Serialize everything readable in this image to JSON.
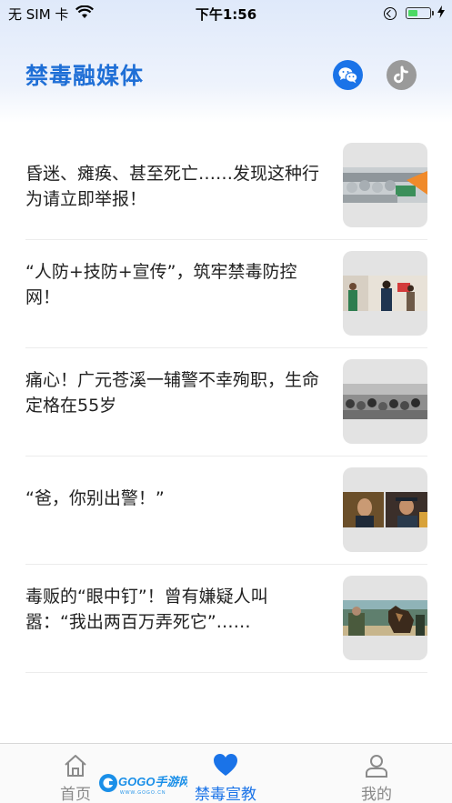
{
  "status_bar": {
    "carrier": "无 SIM 卡",
    "time": "下午1:56",
    "battery_level": 0.45
  },
  "header": {
    "title": "禁毒融媒体",
    "icons": [
      "wechat-icon",
      "douyin-icon"
    ]
  },
  "news": [
    {
      "title": "昏迷、瘫痪、甚至死亡……发现这种行为请立即举报！"
    },
    {
      "title": "“人防+技防+宣传”，筑牢禁毒防控网！"
    },
    {
      "title": "痛心！广元苍溪一辅警不幸殉职，生命定格在55岁"
    },
    {
      "title": "“爸，你别出警！”"
    },
    {
      "title": "毒贩的“眼中钉”！曾有嫌疑人叫嚣：“我出两百万弄死它”……"
    }
  ],
  "tabs": [
    {
      "label": "首页",
      "icon": "home-icon",
      "active": false
    },
    {
      "label": "禁毒宣教",
      "icon": "heart-icon",
      "active": true
    },
    {
      "label": "我的",
      "icon": "user-icon",
      "active": false
    }
  ],
  "watermark": {
    "text": "GOGO手游网",
    "subtext": "WWW.GOGO.CN"
  },
  "colors": {
    "accent": "#1a73e8",
    "title": "#1f6fd6",
    "inactive": "#888888"
  }
}
